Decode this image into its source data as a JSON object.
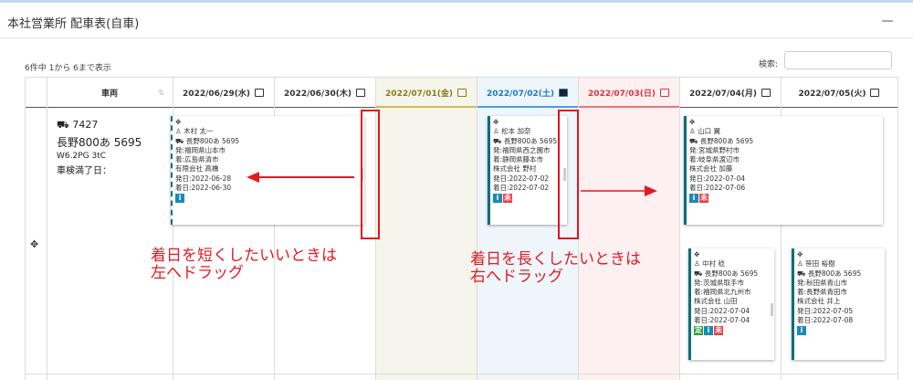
{
  "panel": {
    "title": "本社営業所 配車表(自車)"
  },
  "table_info": {
    "count_text": "6件中 1から 6まで表示"
  },
  "search": {
    "label": "検索:",
    "value": ""
  },
  "headers": {
    "vehicle": "車両",
    "days": [
      {
        "label": "2022/06/29(水)",
        "color": "#333333",
        "comment_filled": false
      },
      {
        "label": "2022/06/30(木)",
        "color": "#333333",
        "comment_filled": false
      },
      {
        "label": "2022/07/01(金)",
        "color": "#8a7a1c",
        "comment_filled": false
      },
      {
        "label": "2022/07/02(土)",
        "color": "#1b7bc2",
        "comment_filled": true
      },
      {
        "label": "2022/07/03(日)",
        "color": "#d9363e",
        "comment_filled": false
      },
      {
        "label": "2022/07/04(月)",
        "color": "#333333",
        "comment_filled": false
      },
      {
        "label": "2022/07/05(火)",
        "color": "#333333",
        "comment_filled": false
      }
    ]
  },
  "vehicle": {
    "number": "7427",
    "plate": "長野800あ 5695",
    "spec": "W6.2PG 3tC",
    "inspection": "車検満了日："
  },
  "cards": [
    {
      "lines": [
        "木村 太一",
        "長野800あ 5695",
        "発:福岡県山本市",
        "着:広島県清市",
        "有限会社 高橋",
        "発日:2022-06-28",
        "着日:2022-06-30"
      ],
      "badges": [
        "i"
      ]
    },
    {
      "lines": [
        "松本 加奈",
        "長野800あ 5695",
        "発:福岡県西之園市",
        "着:静岡県藤本市",
        "株式会社 野村",
        "発日:2022-07-02",
        "着日:2022-07-02"
      ],
      "badges": [
        "i",
        "未"
      ]
    },
    {
      "lines": [
        "山口 翼",
        "長野800あ 5695",
        "発:宮城県野村市",
        "着:岐阜県渡辺市",
        "株式会社 加藤",
        "発日:2022-07-04",
        "着日:2022-07-06"
      ],
      "badges": [
        "i",
        "未"
      ]
    },
    {
      "lines": [
        "中村 稔",
        "長野800あ 5695",
        "発:茨城県取手市",
        "着:福岡県北九州市",
        "株式会社 山田",
        "発日:2022-07-04",
        "着日:2022-07-04"
      ],
      "badges": [
        "定",
        "i",
        "未"
      ]
    },
    {
      "lines": [
        "笹田 裕樹",
        "長野800あ 5695",
        "発:秋田県青山市",
        "着:長野県青田市",
        "株式会社 井上",
        "発日:2022-07-05",
        "着日:2022-07-08"
      ],
      "badges": [
        "i"
      ]
    }
  ],
  "annotations": {
    "shorten": [
      "着日を短くしたいいときは",
      "左へドラッグ"
    ],
    "lengthen": [
      "着日を長くしたいときは",
      "右へドラッグ"
    ]
  },
  "colors": {
    "accent": "#0e6f7a",
    "annotation": "#e21b23",
    "friday_bg": "#f6f5ec",
    "saturday_bg": "#eef6fb",
    "sunday_bg": "#fdf0f1"
  }
}
